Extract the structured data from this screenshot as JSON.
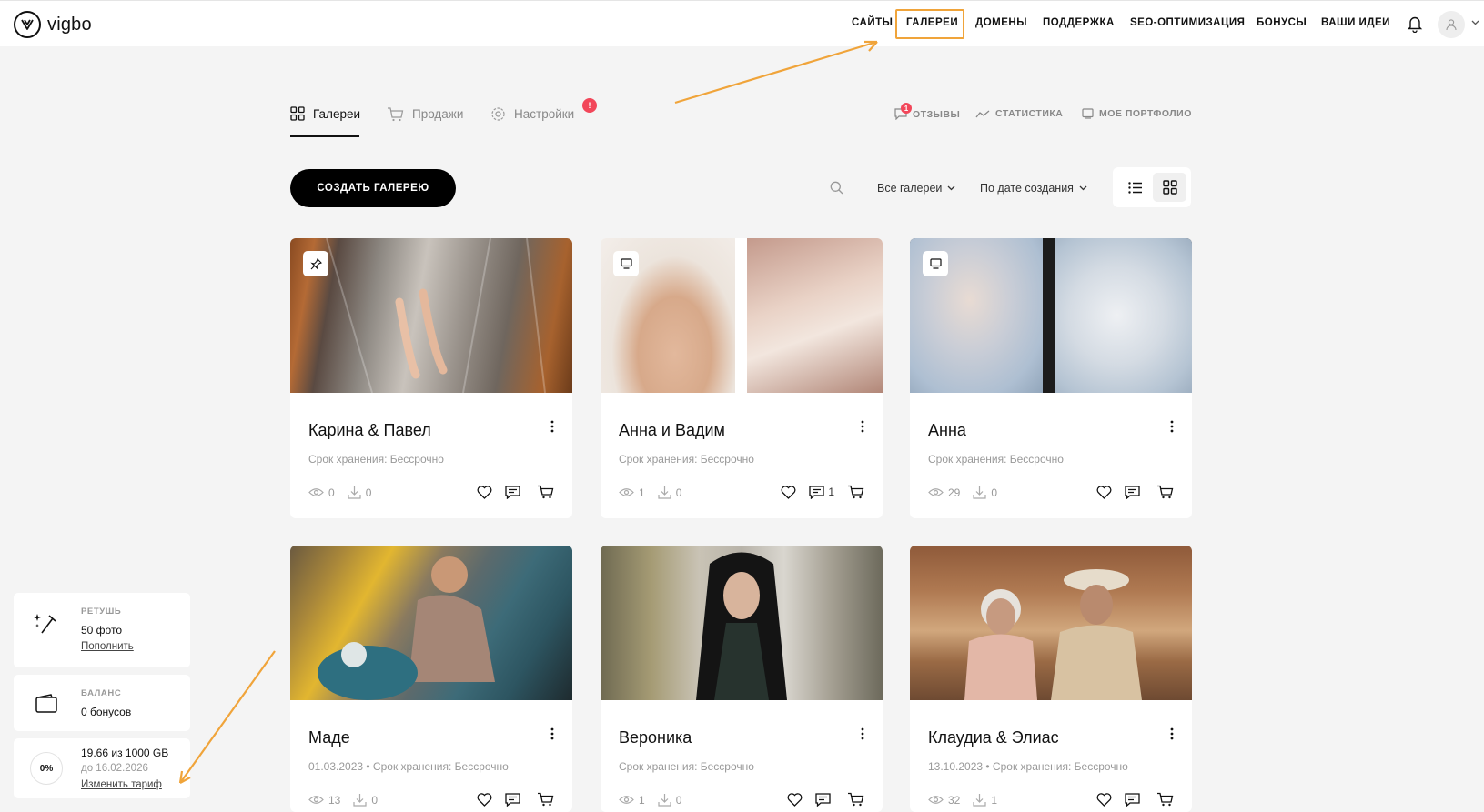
{
  "header": {
    "logo_text": "vigbo",
    "nav": [
      {
        "label": "САЙТЫ"
      },
      {
        "label": "ГАЛЕРЕИ"
      },
      {
        "label": "ДОМЕНЫ"
      },
      {
        "label": "ПОДДЕРЖКА"
      },
      {
        "label": "SEO-ОПТИМИЗАЦИЯ"
      },
      {
        "label": "БОНУСЫ"
      },
      {
        "label": "ВАШИ ИДЕИ"
      }
    ],
    "active_nav": "ГАЛЕРЕИ"
  },
  "tabs": [
    {
      "label": "Галереи",
      "icon": "grid-icon"
    },
    {
      "label": "Продажи",
      "icon": "cart-icon"
    },
    {
      "label": "Настройки",
      "icon": "gear-icon",
      "badge": "!"
    }
  ],
  "right_links": [
    {
      "label": "ОТЗЫВЫ",
      "icon": "comment-icon",
      "badge": "1"
    },
    {
      "label": "СТАТИСТИКА",
      "icon": "chart-icon"
    },
    {
      "label": "МОЕ ПОРТФОЛИО",
      "icon": "portfolio-icon"
    }
  ],
  "toolbar": {
    "create_label": "СОЗДАТЬ ГАЛЕРЕЮ",
    "filter_label": "Все галереи",
    "sort_label": "По дате создания"
  },
  "galleries": [
    {
      "title": "Карина & Павел",
      "meta": "Срок хранения: Бессрочно",
      "views": "0",
      "downloads": "0",
      "comments": "",
      "badge_icon": "pin-icon"
    },
    {
      "title": "Анна и Вадим",
      "meta": "Срок хранения: Бессрочно",
      "views": "1",
      "downloads": "0",
      "comments": "1",
      "badge_icon": "monitor-icon"
    },
    {
      "title": "Анна",
      "meta": "Срок хранения: Бессрочно",
      "views": "29",
      "downloads": "0",
      "comments": "",
      "badge_icon": "monitor-icon"
    },
    {
      "title": "Маде",
      "meta": "01.03.2023 • Срок хранения: Бессрочно",
      "views": "13",
      "downloads": "0",
      "comments": ""
    },
    {
      "title": "Вероника",
      "meta": "Срок хранения: Бессрочно",
      "views": "1",
      "downloads": "0",
      "comments": ""
    },
    {
      "title": "Клаудиа & Элиас",
      "meta": "13.10.2023 • Срок хранения: Бессрочно",
      "views": "32",
      "downloads": "1",
      "comments": ""
    }
  ],
  "widgets": {
    "retouch": {
      "label": "РЕТУШЬ",
      "value": "50 фото",
      "link": "Пополнить"
    },
    "balance": {
      "label": "БАЛАНС",
      "value": "0 бонусов"
    },
    "storage": {
      "percent": "0%",
      "value": "19.66 из 1000 GB",
      "sub": "до 16.02.2026",
      "link": "Изменить тариф"
    }
  },
  "colors": {
    "accent_annotation": "#f0a43a",
    "badge": "#f2475a",
    "primary_button": "#000000"
  }
}
